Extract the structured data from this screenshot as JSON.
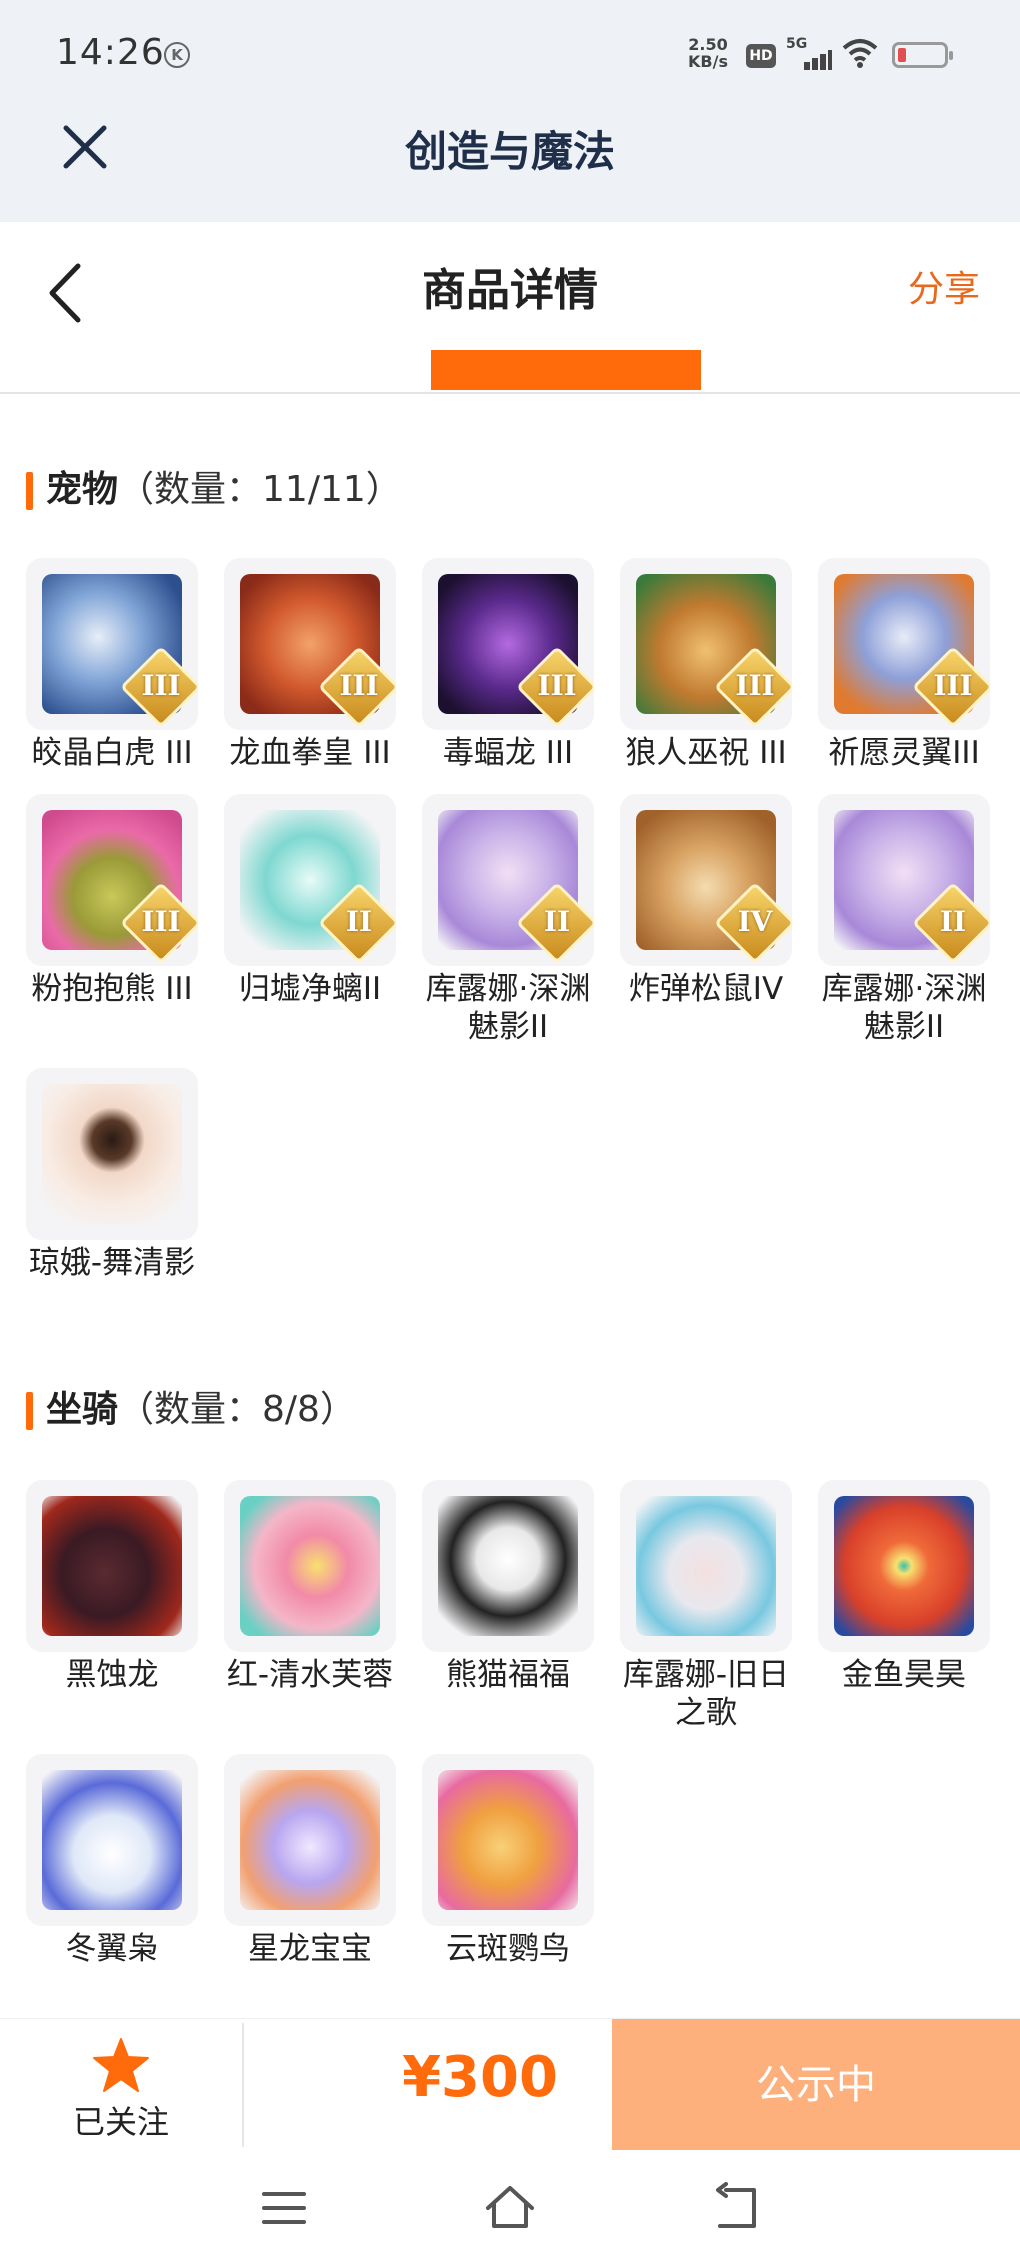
{
  "status_bar": {
    "time": "14:26",
    "k_badge": "K",
    "net_speed": "2.50",
    "net_unit": "KB/s",
    "hd": "HD",
    "network": "5G"
  },
  "app": {
    "title": "创造与魔法",
    "close_icon": "close-icon"
  },
  "page": {
    "title": "商品详情",
    "share_label": "分享",
    "accent_color": "#ff6a0a"
  },
  "sections": {
    "pets": {
      "name": "宠物",
      "count": "（数量：11/11）",
      "items": [
        {
          "label": "皎晶白虎 III",
          "tier": "III"
        },
        {
          "label": "龙血拳皇 III",
          "tier": "III"
        },
        {
          "label": "毒蝠龙 III",
          "tier": "III"
        },
        {
          "label": "狼人巫祝 III",
          "tier": "III"
        },
        {
          "label": "祈愿灵翼III",
          "tier": "III"
        },
        {
          "label": "粉抱抱熊 III",
          "tier": "III"
        },
        {
          "label": "归墟净螭II",
          "tier": "II"
        },
        {
          "label": "库露娜·深渊魅影II",
          "tier": "II"
        },
        {
          "label": "炸弹松鼠IV",
          "tier": "IV"
        },
        {
          "label": "库露娜·深渊魅影II",
          "tier": "II"
        },
        {
          "label": "琼娥-舞清影",
          "tier": ""
        }
      ]
    },
    "mounts": {
      "name": "坐骑",
      "count": "（数量：8/8）",
      "items": [
        {
          "label": "黑蚀龙"
        },
        {
          "label": "红-清水芙蓉"
        },
        {
          "label": "熊猫福福"
        },
        {
          "label": "库露娜-旧日之歌"
        },
        {
          "label": "金鱼昊昊"
        },
        {
          "label": "冬翼枭"
        },
        {
          "label": "星龙宝宝"
        },
        {
          "label": "云斑鹦鸟"
        }
      ]
    }
  },
  "bottom_bar": {
    "follow_label": "已关注",
    "follow_icon": "star-icon",
    "price": "¥300",
    "status_label": "公示中",
    "status_color": "#fdaf7c"
  },
  "system_nav": {
    "menu_icon": "menu-icon",
    "home_icon": "home-icon",
    "back_icon": "back-icon"
  }
}
